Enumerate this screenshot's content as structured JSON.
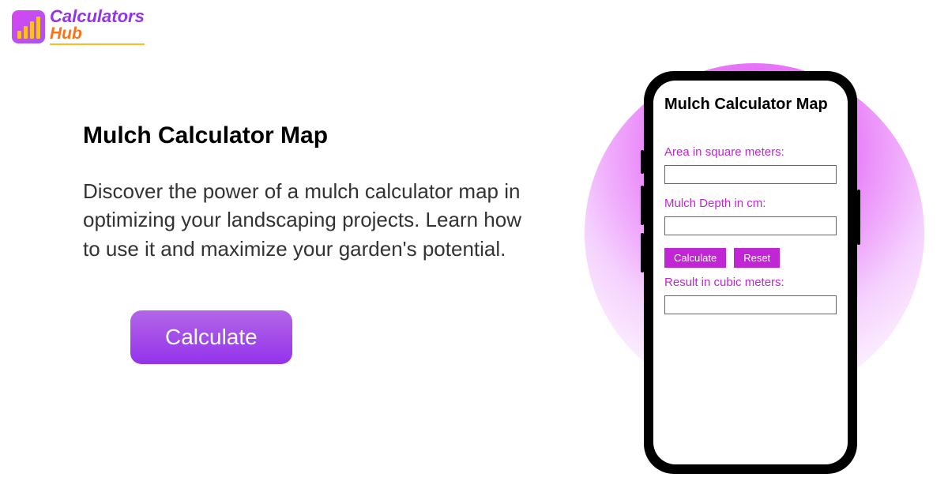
{
  "logo": {
    "text_top": "Calculators",
    "text_bottom": "Hub"
  },
  "hero": {
    "title": "Mulch Calculator Map",
    "description": "Discover the power of a mulch calculator map in optimizing your landscaping projects. Learn how to use it and maximize your garden's potential.",
    "cta_label": "Calculate"
  },
  "phone": {
    "title": "Mulch Calculator Map",
    "area_label": "Area in square meters:",
    "depth_label": "Mulch Depth in cm:",
    "calculate_label": "Calculate",
    "reset_label": "Reset",
    "result_label": "Result in cubic meters:"
  },
  "colors": {
    "accent_purple": "#9333ea",
    "accent_magenta": "#c026d3",
    "accent_orange": "#f97316"
  }
}
